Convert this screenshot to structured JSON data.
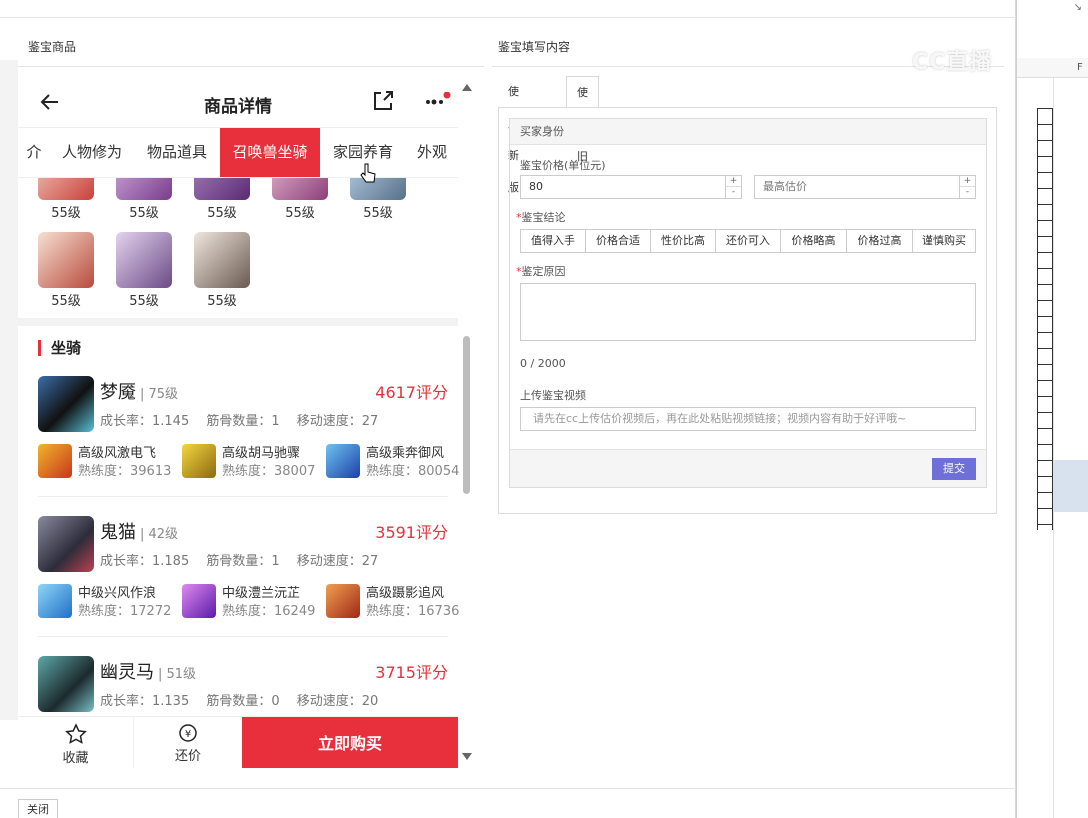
{
  "watermark": "CC直播",
  "sheet": {
    "col_label": "F"
  },
  "dialog": {
    "left_title": "鉴宝商品",
    "right_title": "鉴宝填写内容",
    "close_label": "关闭"
  },
  "phone": {
    "title": "商品详情",
    "tabs": [
      "介",
      "人物修为",
      "物品道具",
      "召唤兽坐骑",
      "家园养育",
      "外观"
    ],
    "active_tab": "召唤兽坐骑",
    "grid_levels": [
      "55级",
      "55级",
      "55级",
      "55级",
      "55级",
      "55级",
      "55级",
      "55级"
    ],
    "section_title": "坐骑",
    "mounts": [
      {
        "name": "梦魇",
        "level": "| 75级",
        "score": "4617评分",
        "stats": "成长率：1.145　 筋骨数量：1　 移动速度：27",
        "skills": [
          {
            "name": "高级风激电飞",
            "prof": "熟练度：39613"
          },
          {
            "name": "高级胡马驰骤",
            "prof": "熟练度：38007"
          },
          {
            "name": "高级乘奔御风",
            "prof": "熟练度：80054"
          }
        ]
      },
      {
        "name": "鬼猫",
        "level": "| 42级",
        "score": "3591评分",
        "stats": "成长率：1.185　 筋骨数量：1　 移动速度：27",
        "skills": [
          {
            "name": "中级兴风作浪",
            "prof": "熟练度：17272"
          },
          {
            "name": "中级澧兰沅芷",
            "prof": "熟练度：16249"
          },
          {
            "name": "高级蹑影追风",
            "prof": "熟练度：16736"
          }
        ]
      },
      {
        "name": "幽灵马",
        "level": "| 51级",
        "score": "3715评分",
        "stats": "成长率：1.135　 筋骨数量：0　 移动速度：20",
        "skills": []
      }
    ],
    "bottom": {
      "fav": "收藏",
      "bargain": "还价",
      "buy": "立即购买"
    }
  },
  "form": {
    "tabs": [
      "使用新版",
      "使用旧版"
    ],
    "active_tab": "使用旧版",
    "panel_title": "买家身份",
    "price_label": "鉴宝价格(单位元)",
    "price_value": "80",
    "max_placeholder": "最高估价",
    "conclusion_label": "鉴宝结论",
    "conclusions": [
      "值得入手",
      "价格合适",
      "性价比高",
      "还价可入",
      "价格略高",
      "价格过高",
      "谨慎购买"
    ],
    "reason_label": "鉴定原因",
    "counter": "0 / 2000",
    "video_label": "上传鉴宝视频",
    "video_placeholder": "请先在cc上传估价视频后，再在此处粘贴视频链接；视频内容有助于好评哦~",
    "submit": "提交"
  },
  "colors": {
    "accent": "#e8303d",
    "submit": "#6f6fd8"
  }
}
